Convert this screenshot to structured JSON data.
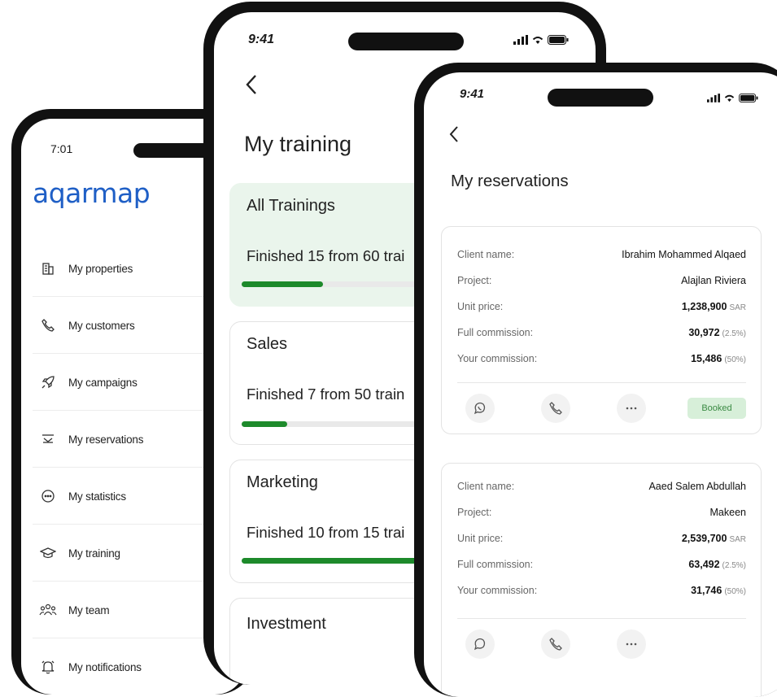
{
  "menu_screen": {
    "time": "7:01",
    "logo": "aqarmap",
    "items": [
      {
        "label": "My properties",
        "icon": "building-icon"
      },
      {
        "label": "My customers",
        "icon": "phone-icon"
      },
      {
        "label": "My campaigns",
        "icon": "rocket-icon"
      },
      {
        "label": "My reservations",
        "icon": "reservations-icon"
      },
      {
        "label": "My statistics",
        "icon": "chat-icon"
      },
      {
        "label": "My training",
        "icon": "graduation-cap-icon"
      },
      {
        "label": "My team",
        "icon": "team-icon"
      },
      {
        "label": "My notifications",
        "icon": "bell-icon"
      }
    ]
  },
  "training_screen": {
    "time": "9:41",
    "title": "My training",
    "cards": [
      {
        "name": "All Trainings",
        "progress_text": "Finished 15 from 60 trai",
        "progress": 0.25
      },
      {
        "name": "Sales",
        "progress_text": "Finished 7 from 50 train",
        "progress": 0.14
      },
      {
        "name": "Marketing",
        "progress_text": "Finished 10 from 15 trai",
        "progress": 0.67
      },
      {
        "name": "Investment"
      }
    ]
  },
  "reservations_screen": {
    "time": "9:41",
    "title": "My reservations",
    "labels": {
      "client": "Client name:",
      "project": "Project:",
      "unit_price": "Unit price:",
      "full_commission": "Full commission:",
      "your_commission": "Your commission:"
    },
    "reservations": [
      {
        "client_name": "Ibrahim  Mohammed Alqaed",
        "project": "Alajlan Riviera",
        "unit_price": "1,238,900",
        "currency": "SAR",
        "full_commission": "30,972",
        "full_commission_pct": "(2.5%)",
        "your_commission": "15,486",
        "your_commission_pct": "(50%)",
        "status": "Booked"
      },
      {
        "client_name": "Aaed Salem Abdullah",
        "project": "Makeen",
        "unit_price": "2,539,700",
        "currency": "SAR",
        "full_commission": "63,492",
        "full_commission_pct": "(2.5%)",
        "your_commission": "31,746",
        "your_commission_pct": "(50%)"
      }
    ],
    "action_icons": [
      "whatsapp-icon",
      "phone-icon",
      "more-icon"
    ]
  },
  "colors": {
    "brand": "#1f5fc6",
    "progress": "#1d8a2b",
    "active_card": "#eaf5ec",
    "booked_bg": "#d7efd9",
    "booked_text": "#3a8a43"
  }
}
